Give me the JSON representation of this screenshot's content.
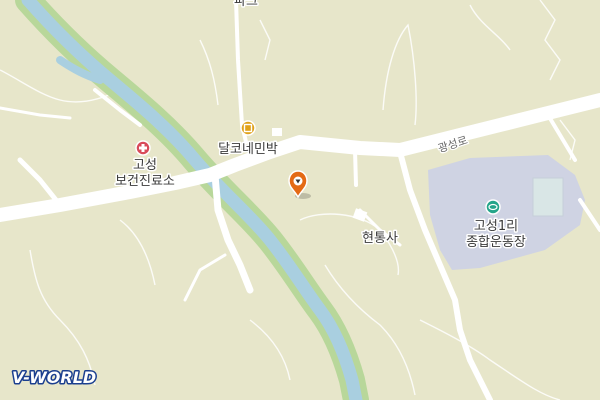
{
  "map": {
    "brand": "V-WORLD",
    "partial_label_top": "파크",
    "places": [
      {
        "name": "고성\n보건진료소",
        "icon": "hospital-icon"
      },
      {
        "name": "달코네민박",
        "icon": "lodging-icon"
      },
      {
        "name": "현통사",
        "icon": "temple-icon"
      },
      {
        "name": "고성1리\n종합운동장",
        "icon": "stadium-icon"
      }
    ],
    "road_label": "광성로",
    "marker": {
      "icon": "location-pin-icon"
    },
    "colors": {
      "land": "#e7e6ca",
      "road": "#ffffff",
      "river": "#a9cfe0",
      "river_bank": "#b8d79a",
      "stadium_area": "#cfd3e3",
      "hospital": "#d84a5a",
      "lodging": "#e0a21a",
      "stadium_icon": "#24a58a",
      "marker": "#e46a14"
    }
  }
}
